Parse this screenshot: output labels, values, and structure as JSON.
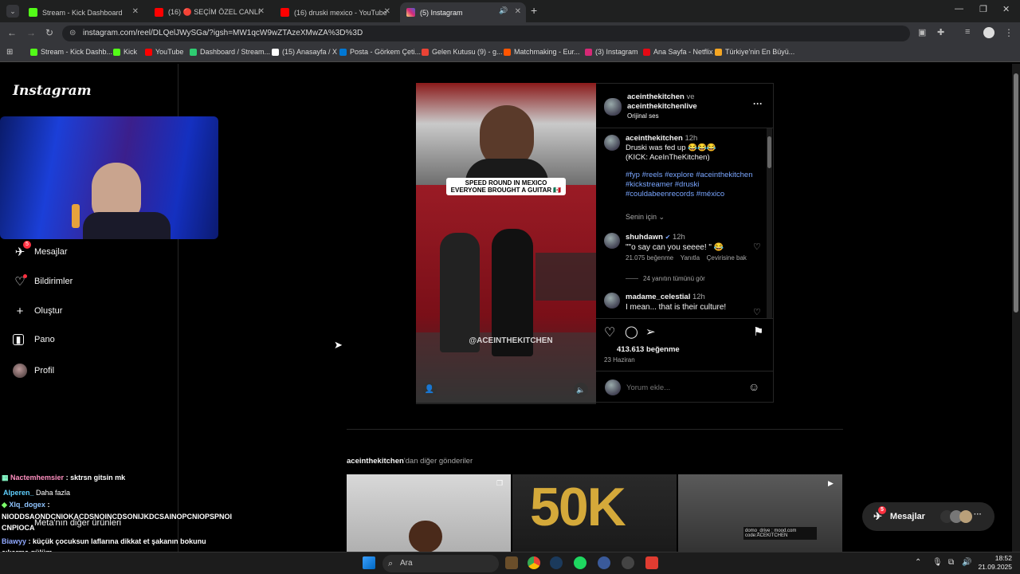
{
  "browser": {
    "tabs": [
      {
        "label": "Stream - Kick Dashboard",
        "fav": "#53fc18"
      },
      {
        "label": "(16) 🔴 SEÇİM ÖZEL CANLI | Ki",
        "fav": "#ff0000"
      },
      {
        "label": "(16) druski mexico - YouTube",
        "fav": "#ff0000"
      },
      {
        "label": "(5) Instagram",
        "fav": "#d62976"
      }
    ],
    "url": "instagram.com/reel/DLQelJWySGa/?igsh=MW1qcW9wZTAzeXMwZA%3D%3D",
    "bookmarks": [
      {
        "label": "Stream - Kick Dashb...",
        "fav": "#53fc18"
      },
      {
        "label": "Kick",
        "fav": "#53fc18"
      },
      {
        "label": "YouTube",
        "fav": "#ff0000"
      },
      {
        "label": "Dashboard / Stream...",
        "fav": "#2ecc71"
      },
      {
        "label": "(15) Anasayfa / X",
        "fav": "#ffffff"
      },
      {
        "label": "Posta - Görkem Çeti...",
        "fav": "#0078d4"
      },
      {
        "label": "Gelen Kutusu (9) - g...",
        "fav": "#ea4335"
      },
      {
        "label": "Matchmaking - Eur...",
        "fav": "#ff5500"
      },
      {
        "label": "(3) Instagram",
        "fav": "#d62976"
      },
      {
        "label": "Ana Sayfa - Netflix",
        "fav": "#e50914"
      },
      {
        "label": "Türkiye'nin En Büyü...",
        "fav": "#f5a623"
      }
    ]
  },
  "instagram": {
    "logo": "Instagram",
    "nav": [
      {
        "label": "Mesajlar",
        "badge": "5"
      },
      {
        "label": "Bildirimler"
      },
      {
        "label": "Oluştur"
      },
      {
        "label": "Pano"
      },
      {
        "label": "Profil"
      }
    ],
    "reel": {
      "caption_line1": "SPEED ROUND IN MEXICO",
      "caption_line2": "EVERYONE BROUGHT A GUITAR 🇲🇽",
      "watermark": "@ACEINTHEKITCHEN"
    },
    "header": {
      "author": "aceinthekitchen",
      "connector": "ve",
      "coauthor": "aceinthekitchenlive",
      "audio": "Orijinal ses"
    },
    "post": {
      "author": "aceinthekitchen",
      "time": "12h",
      "text1": "Druski was fed up 😂😂😂",
      "text2": "(KICK: AceInTheKitchen)",
      "hashtags1": "#fyp #reels #explore #aceinthekitchen",
      "hashtags2": "#kickstreamer #druski",
      "hashtags3": "#couldabeenrecords #méxico",
      "for_you": "Senin için"
    },
    "comments": [
      {
        "user": "shuhdawn",
        "time": "12h",
        "text": "\"\"o say can you seeee! \" 😂",
        "likes": "21.075 beğenme",
        "reply": "Yanıtla",
        "translate": "Çevirisine bak",
        "view_replies": "24 yanıtın tümünü gör"
      },
      {
        "user": "madame_celestial",
        "time": "12h",
        "text": "I mean... that is their culture!"
      }
    ],
    "likes": "413.613 beğenme",
    "date": "23 Haziran",
    "comment_placeholder": "Yorum ekle...",
    "more_from_user": "aceinthekitchen",
    "more_from_suffix": "'dan diğer gönderiler",
    "meta_products": "Meta'nın diğer ürünleri",
    "messages_pill": "Mesajlar",
    "messages_badge": "5",
    "thumb_text": "50K",
    "thumb_overlay1": "domo_drive : mood.com",
    "thumb_overlay2": "code:ACEKITCHEN"
  },
  "chat": [
    {
      "user": "Nactemhemsier",
      "color": "#ff5fa2",
      "msg": ": sktrsn gitsin mk"
    },
    {
      "user": "Alperen_",
      "color": "#5fd0ff",
      "msg": "Daha fazla"
    },
    {
      "user": "Xlq_dogex",
      "color": "#7bff6b",
      "msg": ":"
    },
    {
      "user": "",
      "color": "#ffffff",
      "msg": "NIODDSAONDCNIOKACDSNOINCDSONIJKDCSAINOPCNIOPSPNOI"
    },
    {
      "user": "",
      "color": "#ffffff",
      "msg": "CNPIOCA"
    },
    {
      "user": "Biawyy",
      "color": "#6b8cff",
      "msg": ": küçük çocuksun laflarına dikkat et şakanın bokunu"
    },
    {
      "user": "",
      "color": "#ffffff",
      "msg": "çıkarma gülüm"
    }
  ],
  "taskbar": {
    "search": "Ara",
    "time": "18:52",
    "date": "21.09.2025"
  }
}
